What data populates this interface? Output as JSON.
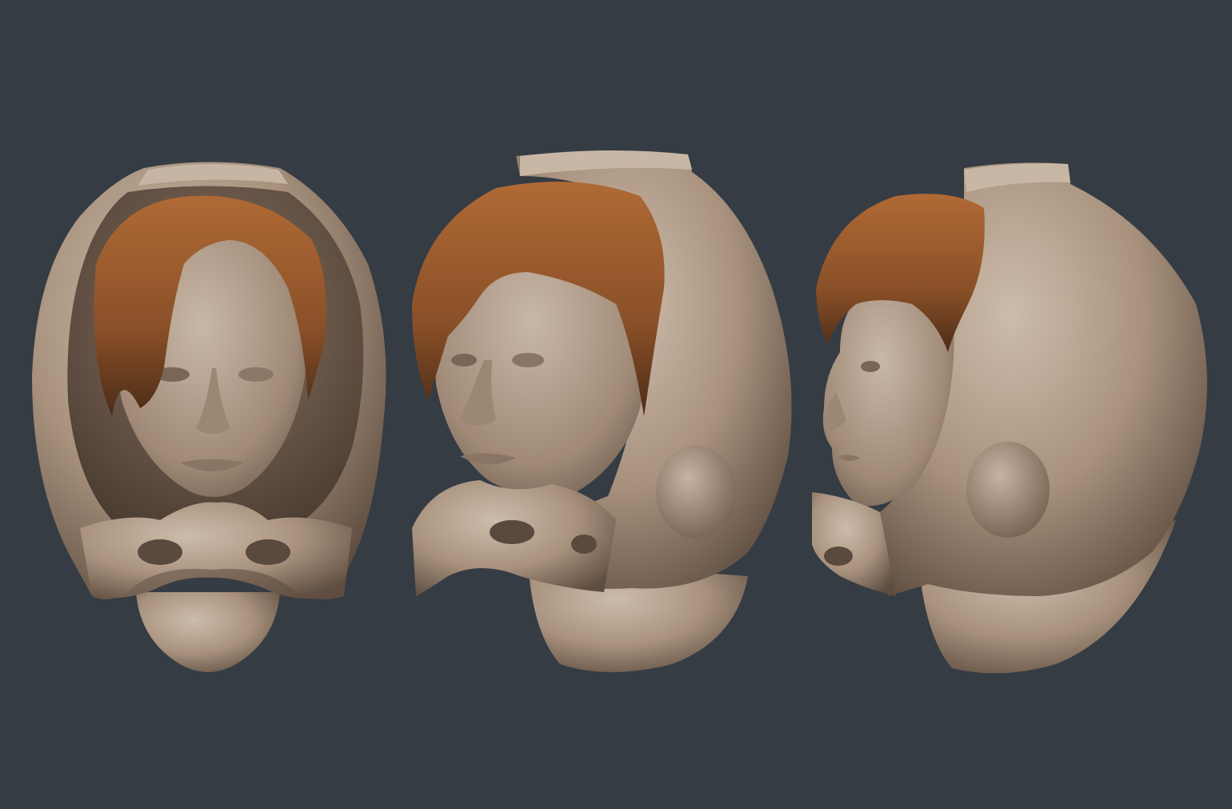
{
  "scene": {
    "background": "#363c44",
    "material_color": "#b8a593",
    "hair_color": "#9a5a2e",
    "views": [
      {
        "name": "front"
      },
      {
        "name": "three-quarter"
      },
      {
        "name": "side"
      }
    ]
  }
}
